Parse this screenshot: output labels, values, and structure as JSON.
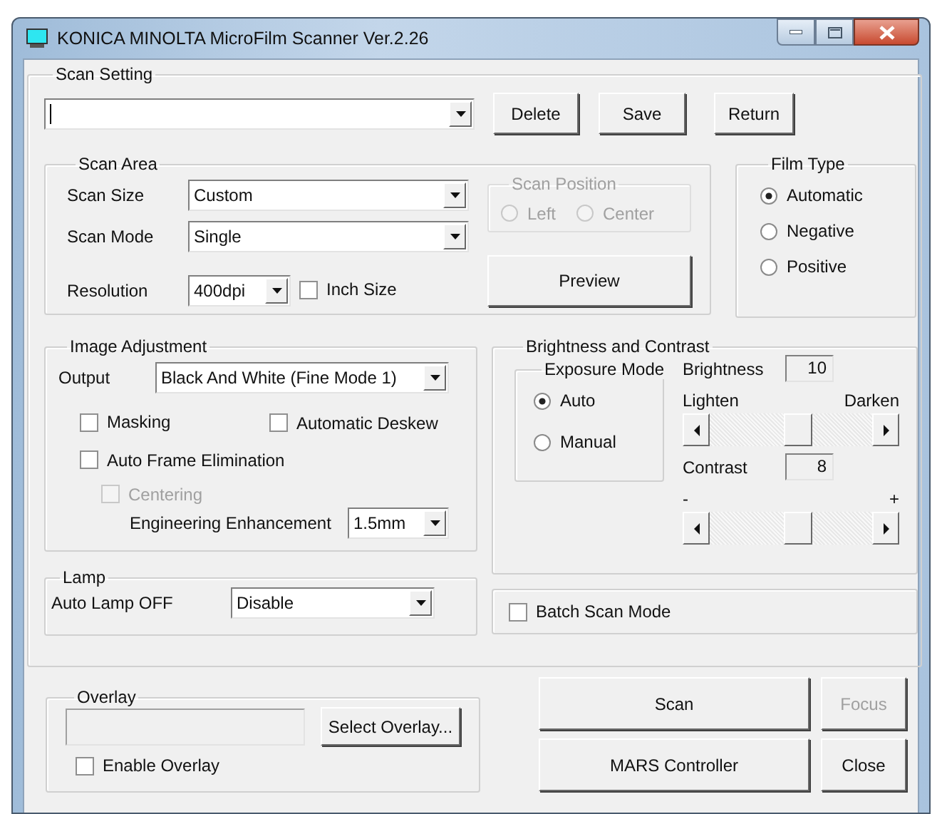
{
  "window": {
    "title": "KONICA MINOLTA MicroFilm Scanner Ver.2.26"
  },
  "scan_setting": {
    "title": "Scan Setting",
    "buttons": [
      "Delete",
      "Save",
      "Return"
    ]
  },
  "scan_area": {
    "title": "Scan Area",
    "fields": [
      {
        "label": "Scan Size",
        "value": "Custom"
      },
      {
        "label": "Scan Mode",
        "value": "Single"
      }
    ],
    "resolution": {
      "label": "Resolution",
      "value": "400dpi"
    },
    "inch_size": {
      "label": "Inch Size",
      "checked": false
    },
    "scan_position": {
      "title": "Scan Position",
      "disabled": true,
      "options": [
        {
          "label": "Left",
          "selected": false
        },
        {
          "label": "Center",
          "selected": false
        }
      ]
    },
    "preview_button": "Preview"
  },
  "film_type": {
    "title": "Film Type",
    "options": [
      {
        "label": "Automatic",
        "selected": true
      },
      {
        "label": "Negative",
        "selected": false
      },
      {
        "label": "Positive",
        "selected": false
      }
    ]
  },
  "image_adjustment": {
    "title": "Image Adjustment",
    "output": {
      "label": "Output",
      "value": "Black And White (Fine Mode 1)"
    },
    "checkboxes": [
      {
        "label": "Masking",
        "checked": false,
        "disabled": false
      },
      {
        "label": "Automatic Deskew",
        "checked": false,
        "disabled": false
      },
      {
        "label": "Auto Frame Elimination",
        "checked": false,
        "disabled": false
      },
      {
        "label": "Centering",
        "checked": false,
        "disabled": true
      }
    ],
    "enhancement": {
      "label": "Engineering Enhancement",
      "value": "1.5mm"
    }
  },
  "lamp": {
    "title": "Lamp",
    "label": "Auto Lamp OFF",
    "value": "Disable"
  },
  "brightness_contrast": {
    "title": "Brightness and Contrast",
    "exposure_mode": {
      "title": "Exposure Mode",
      "options": [
        {
          "label": "Auto",
          "selected": true
        },
        {
          "label": "Manual",
          "selected": false
        }
      ]
    },
    "sliders": [
      {
        "label": "Brightness",
        "value": "10",
        "left": "Lighten",
        "right": "Darken",
        "level": 0.55
      },
      {
        "label": "Contrast",
        "value": "8",
        "left": "-",
        "right": "+",
        "level": 0.55
      }
    ]
  },
  "batch_scan": {
    "label": "Batch Scan Mode",
    "checked": false
  },
  "overlay": {
    "title": "Overlay",
    "button": "Select Overlay...",
    "enable": {
      "label": "Enable Overlay",
      "checked": false
    }
  },
  "actions": [
    {
      "label": "Scan",
      "disabled": false
    },
    {
      "label": "Focus",
      "disabled": true
    },
    {
      "label": "MARS Controller",
      "disabled": false
    },
    {
      "label": "Close",
      "disabled": false
    }
  ]
}
